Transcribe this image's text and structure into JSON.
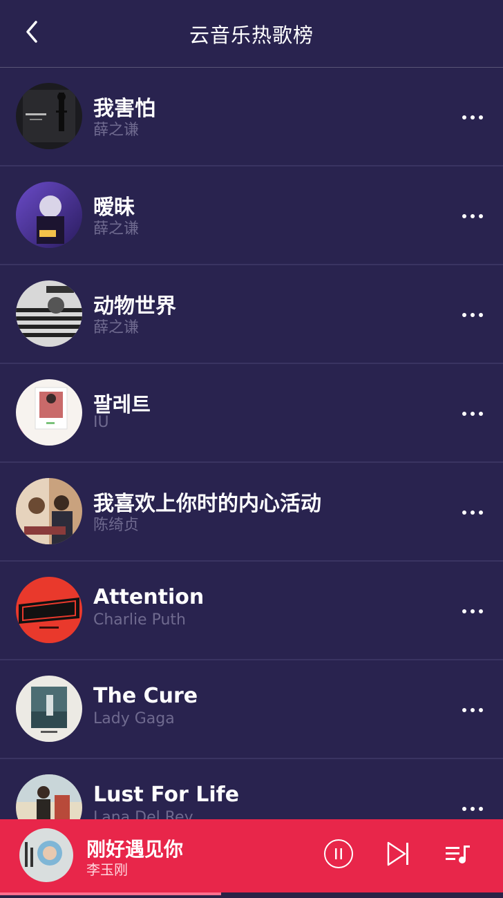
{
  "header": {
    "title": "云音乐热歌榜",
    "back_icon": "chevron-left-icon"
  },
  "songs": [
    {
      "title": "我害怕",
      "artist": "薛之谦"
    },
    {
      "title": "暧昧",
      "artist": "薛之谦"
    },
    {
      "title": "动物世界",
      "artist": "薛之谦"
    },
    {
      "title": "팔레트",
      "artist": "IU"
    },
    {
      "title": "我喜欢上你时的内心活动",
      "artist": "陈绮贞"
    },
    {
      "title": "Attention",
      "artist": "Charlie Puth"
    },
    {
      "title": "The Cure",
      "artist": "Lady Gaga"
    },
    {
      "title": "Lust For Life",
      "artist": "Lana Del Rey"
    }
  ],
  "row_more_icon": "more-horizontal-icon",
  "now_playing": {
    "title": "刚好遇见你",
    "artist": "李玉刚",
    "pause_icon": "pause-icon",
    "next_icon": "skip-next-icon",
    "playlist_icon": "playlist-icon",
    "progress_fraction": 0.44
  },
  "colors": {
    "background": "#29234f",
    "player_bar": "#e8264a",
    "artist_text": "#6f6a8f",
    "progress": "#ff6f8e"
  }
}
